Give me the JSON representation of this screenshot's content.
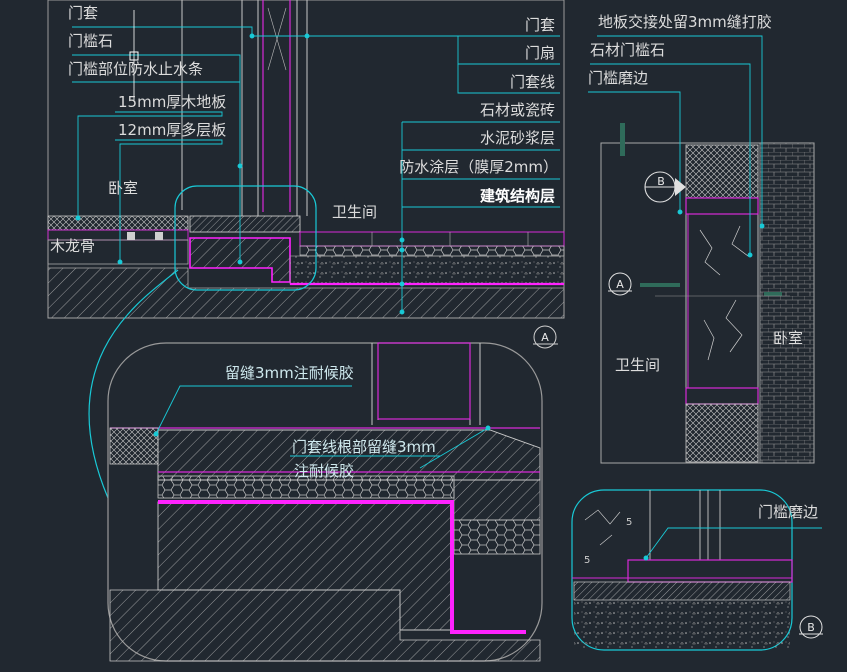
{
  "colors": {
    "background": "#212830",
    "leader": "#19c9d6",
    "outline": "#a8a8a8",
    "magenta": "#d82ad8",
    "highlight": "#ff22ff",
    "hatch": "#c8c8c8",
    "text": "#dcdcdc",
    "marker_dark": "#2f6b5a"
  },
  "section_a": {
    "labels_left": [
      "门套",
      "门槛石",
      "门槛部位防水止水条",
      "15mm厚木地板",
      "12mm厚多层板"
    ],
    "labels_right": [
      "门套",
      "门扇",
      "门套线",
      "石材或瓷砖",
      "水泥砂浆层",
      "防水涂层（膜厚2mm）",
      "建筑结构层"
    ],
    "room_left": "卧室",
    "room_right": "卫生间",
    "keel": "木龙骨",
    "marker": "A"
  },
  "detail": {
    "note_sealant": "留缝3mm注耐候胶",
    "note_trim_1": "门套线根部留缝3mm",
    "note_trim_2": "注耐候胶"
  },
  "plan": {
    "label_joint": "地板交接处留3mm缝打胶",
    "label_stone": "石材门槛石",
    "label_edge": "门槛磨边",
    "room_bath": "卫生间",
    "room_bed": "卧室",
    "marker_a": "A",
    "marker_b": "B"
  },
  "detail_b": {
    "label_edge": "门槛磨边",
    "dim_1": "5",
    "dim_2": "5",
    "marker": "B"
  }
}
